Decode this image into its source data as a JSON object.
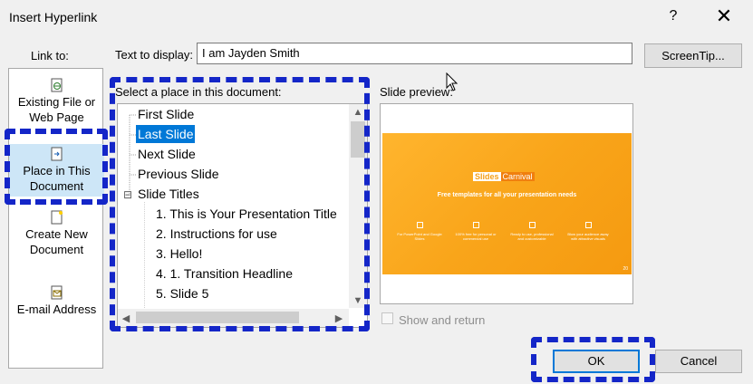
{
  "window": {
    "title": "Insert Hyperlink",
    "help_label": "?",
    "close_label": "✕"
  },
  "link_to": {
    "label": "Link to:",
    "items": [
      {
        "label": "Existing File or Web Page",
        "icon": "globe-file-icon",
        "selected": false
      },
      {
        "label": "Place in This Document",
        "icon": "document-place-icon",
        "selected": true
      },
      {
        "label": "Create New Document",
        "icon": "new-document-icon",
        "selected": false
      },
      {
        "label": "E-mail Address",
        "icon": "email-icon",
        "selected": false
      }
    ]
  },
  "text_to_display": {
    "label": "Text to display:",
    "value": "I am Jayden Smith"
  },
  "screentip_label": "ScreenTip...",
  "place_list": {
    "label": "Select a place in this document:",
    "items": [
      {
        "label": "First Slide",
        "level": 0
      },
      {
        "label": "Last Slide",
        "level": 0,
        "selected": true
      },
      {
        "label": "Next Slide",
        "level": 0
      },
      {
        "label": "Previous Slide",
        "level": 0
      },
      {
        "label": "Slide Titles",
        "level": 0,
        "expander": "⊟"
      },
      {
        "label": "1. This is Your Presentation Title",
        "level": 1
      },
      {
        "label": "2. Instructions for use",
        "level": 1
      },
      {
        "label": "3. Hello!",
        "level": 1
      },
      {
        "label": "4. 1. Transition Headline",
        "level": 1
      },
      {
        "label": "5. Slide 5",
        "level": 1
      }
    ]
  },
  "preview": {
    "label": "Slide preview:",
    "slide": {
      "logo_part1": "Slides",
      "logo_part2": "Carnival",
      "subtitle": "Free templates for all your presentation needs",
      "columns": [
        "For PowerPoint and Google Slides",
        "100% free for personal or commercial use",
        "Ready to use, professional and customizable",
        "Blow your audience away with attractive visuals"
      ],
      "page_number": "20"
    },
    "show_and_return_label": "Show and return"
  },
  "buttons": {
    "ok": "OK",
    "cancel": "Cancel"
  },
  "colors": {
    "highlight_dash": "#1426c8",
    "selection": "#0078d7",
    "slide_orange": "#f9a51a"
  }
}
